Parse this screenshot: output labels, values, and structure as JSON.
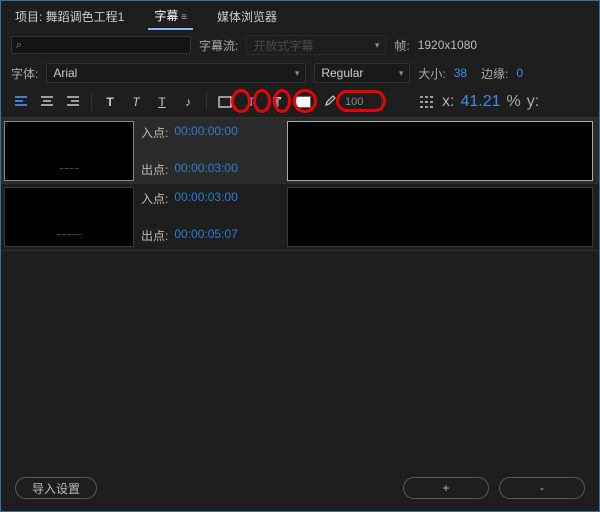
{
  "tabs": {
    "project": "项目: 舞蹈调色工程1",
    "captions": "字幕",
    "media": "媒体浏览器"
  },
  "search": {
    "icon": "⌕",
    "placeholder": ""
  },
  "stream": {
    "label": "字幕流:",
    "value": "开放式字幕"
  },
  "frame": {
    "label": "帧:",
    "value": "1920x1080"
  },
  "font": {
    "label": "字体:",
    "family": "Arial",
    "style": "Regular",
    "size_label": "大小:",
    "size": "38",
    "edge_label": "边缘:",
    "edge": "0"
  },
  "toolbar": {
    "opacity": "100",
    "x_label": "x:",
    "x": "41.21",
    "pct": "%",
    "y_label": "y:"
  },
  "clips": [
    {
      "in_label": "入点:",
      "in": "00:00:00:00",
      "out_label": "出点:",
      "out": "00:00:03:00",
      "selected": true
    },
    {
      "in_label": "入点:",
      "in": "00:00:03:00",
      "out_label": "出点:",
      "out": "00:00:05:07",
      "selected": false
    }
  ],
  "footer": {
    "import": "导入设置",
    "plus": "+",
    "minus": "-"
  }
}
